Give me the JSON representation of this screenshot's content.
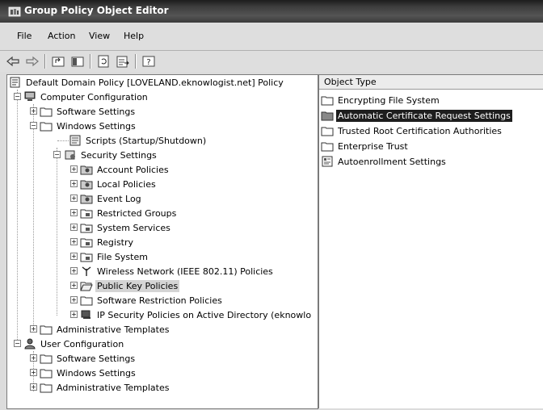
{
  "window": {
    "title": "Group Policy Object Editor"
  },
  "menu": {
    "file": "File",
    "action": "Action",
    "view": "View",
    "help": "Help"
  },
  "tree": {
    "root": "Default Domain Policy [LOVELAND.eknowlogist.net] Policy",
    "computer_configuration": "Computer Configuration",
    "software_settings": "Software Settings",
    "windows_settings": "Windows Settings",
    "scripts": "Scripts (Startup/Shutdown)",
    "security_settings": "Security Settings",
    "account_policies": "Account Policies",
    "local_policies": "Local Policies",
    "event_log": "Event Log",
    "restricted_groups": "Restricted Groups",
    "system_services": "System Services",
    "registry": "Registry",
    "file_system": "File System",
    "wireless_network": "Wireless Network (IEEE 802.11) Policies",
    "public_key_policies": "Public Key Policies",
    "software_restriction": "Software Restriction Policies",
    "ip_security": "IP Security Policies on Active Directory (eknowlo",
    "admin_templates": "Administrative Templates",
    "user_configuration": "User Configuration",
    "user_software_settings": "Software Settings",
    "user_windows_settings": "Windows Settings",
    "user_admin_templates": "Administrative Templates"
  },
  "list": {
    "column_header": "Object Type",
    "items": [
      "Encrypting File System",
      "Automatic Certificate Request Settings",
      "Trusted Root Certification Authorities",
      "Enterprise Trust",
      "Autoenrollment Settings"
    ]
  }
}
